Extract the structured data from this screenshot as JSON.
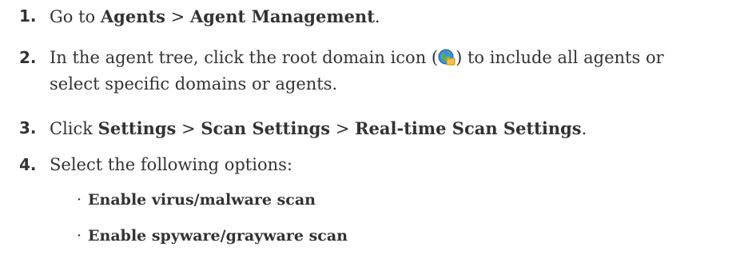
{
  "steps": [
    {
      "number": "1.",
      "text": {
        "a": "Go to ",
        "b": "Agents",
        "c": " > ",
        "d": "Agent Management",
        "e": "."
      }
    },
    {
      "number": "2.",
      "line1_before": "In the agent tree, click the root domain icon (",
      "line1_after": ") to include all agents or",
      "line2": "select specific domains or agents.",
      "icon": "root-domain-globe-icon"
    },
    {
      "number": "3.",
      "text": {
        "a": "Click ",
        "b": "Settings",
        "c": " > ",
        "d": "Scan Settings",
        "e": " > ",
        "f": "Real-time Scan Settings",
        "g": "."
      }
    },
    {
      "number": "4.",
      "text": "Select the following options:",
      "options": [
        "Enable virus/malware scan",
        "Enable spyware/grayware scan"
      ],
      "bullet": "·"
    }
  ]
}
